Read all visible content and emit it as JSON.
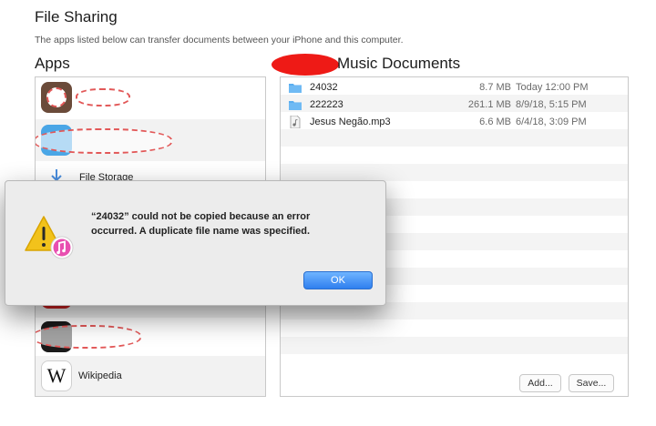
{
  "page": {
    "title": "File Sharing",
    "subtitle": "The apps listed below can transfer documents between your iPhone and this computer."
  },
  "apps": {
    "heading": "Apps",
    "items": [
      {
        "label": ""
      },
      {
        "label": ""
      },
      {
        "label": "File Storage"
      },
      {
        "label": ""
      },
      {
        "label": ""
      },
      {
        "label": "Wikipedia"
      }
    ]
  },
  "documents": {
    "heading": "Music Documents",
    "files": [
      {
        "name": "24032",
        "size": "8.7 MB",
        "date": "Today 12:00 PM",
        "icon": "folder-icon"
      },
      {
        "name": "222223",
        "size": "261.1 MB",
        "date": "8/9/18, 5:15 PM",
        "icon": "folder-icon"
      },
      {
        "name": "Jesus Negão.mp3",
        "size": "6.6 MB",
        "date": "6/4/18, 3:09 PM",
        "icon": "audio-file-icon"
      }
    ],
    "add_label": "Add...",
    "save_label": "Save..."
  },
  "alert": {
    "message_line1": "“24032” could not be copied because an error",
    "message_line2": "occurred. A duplicate file name was specified.",
    "ok_label": "OK",
    "icon": "warning-icon"
  },
  "colors": {
    "accent": "#2f7fef",
    "redaction": "#ee1a16",
    "folder": "#5aaef0"
  }
}
